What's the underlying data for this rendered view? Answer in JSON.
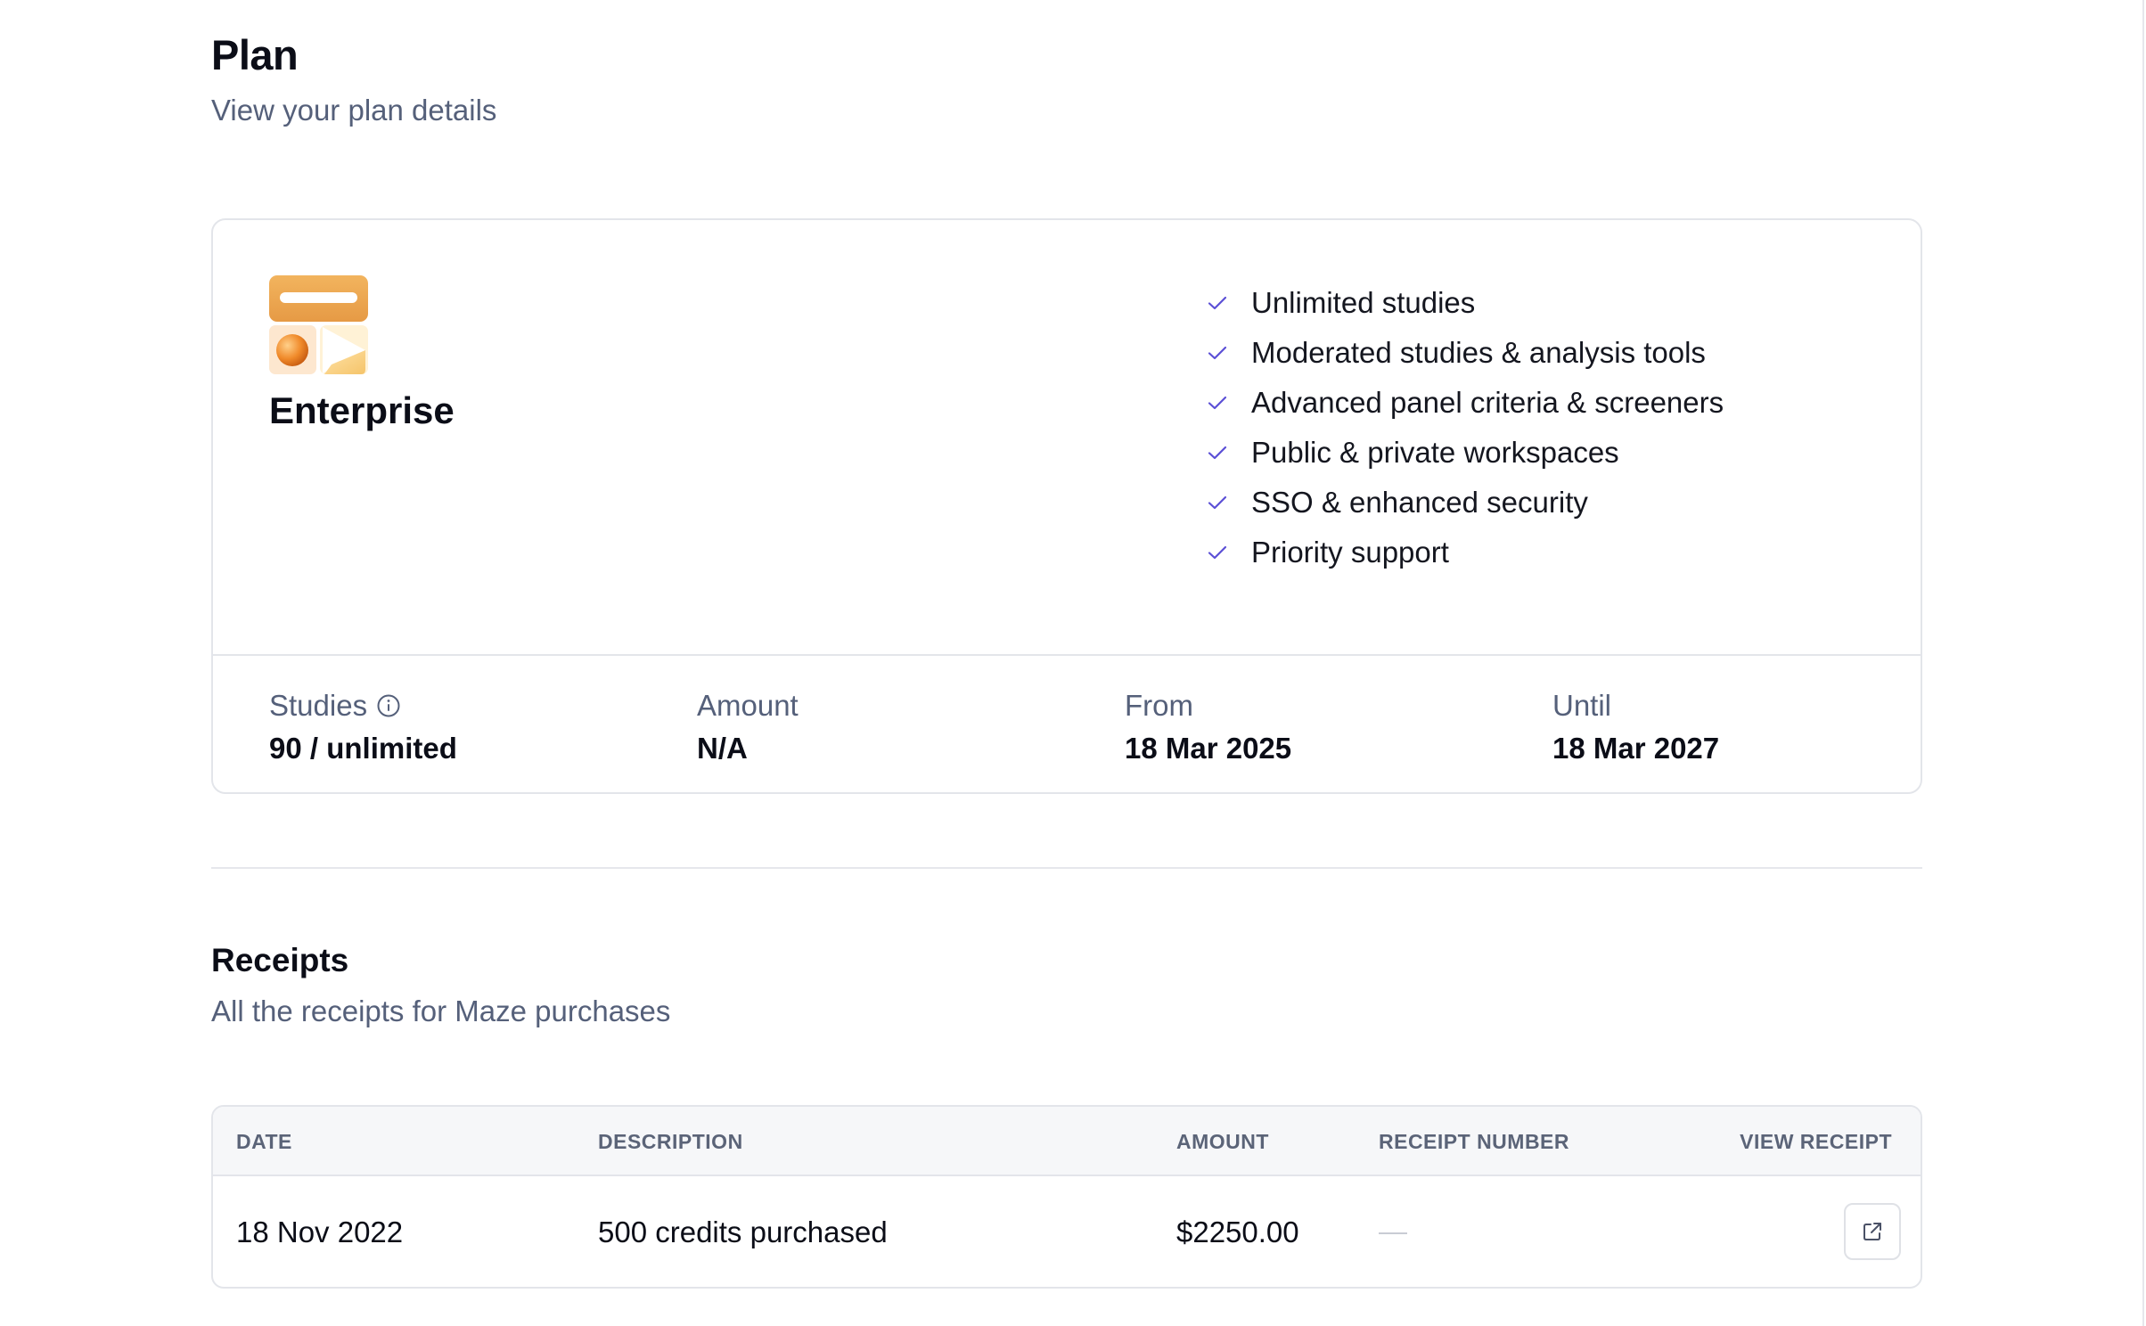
{
  "header": {
    "title": "Plan",
    "subtitle": "View your plan details"
  },
  "plan": {
    "icon": "enterprise-plan-illustration",
    "name": "Enterprise",
    "features": [
      "Unlimited studies",
      "Moderated studies & analysis tools",
      "Advanced panel criteria & screeners",
      "Public & private workspaces",
      "SSO & enhanced security",
      "Priority support"
    ],
    "stats": {
      "studies_label": "Studies",
      "studies_value": "90 / unlimited",
      "amount_label": "Amount",
      "amount_value": "N/A",
      "from_label": "From",
      "from_value": "18 Mar 2025",
      "until_label": "Until",
      "until_value": "18 Mar 2027"
    }
  },
  "receipts": {
    "title": "Receipts",
    "subtitle": "All the receipts for Maze purchases",
    "columns": {
      "date": "DATE",
      "description": "DESCRIPTION",
      "amount": "AMOUNT",
      "receipt_number": "RECEIPT NUMBER",
      "view_receipt": "VIEW RECEIPT"
    },
    "rows": [
      {
        "date": "18 Nov 2022",
        "description": "500 credits purchased",
        "amount": "$2250.00",
        "receipt_number": "",
        "view_icon": "external-link-icon"
      }
    ]
  },
  "colors": {
    "check": "#5b4fd6",
    "muted_text": "#55607a",
    "border": "#e3e5ea",
    "header_bg": "#f6f7f9"
  }
}
